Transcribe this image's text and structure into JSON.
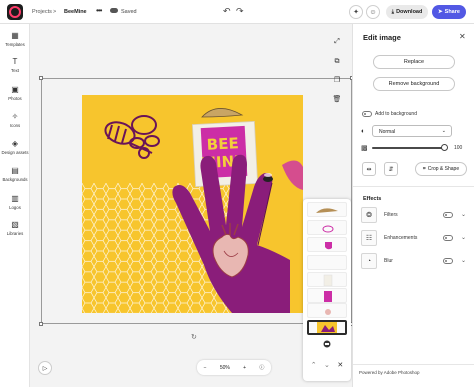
{
  "topbar": {
    "breadcrumb_projects": "Projects",
    "breadcrumb_sep": ">",
    "project_name": "BeeMine",
    "more": "•••",
    "saved_status": "Saved",
    "undo": "↶",
    "redo": "↷",
    "download_label": "Download",
    "share_label": "Share"
  },
  "sidebar": {
    "items": [
      {
        "label": "Templates",
        "icon": "▦"
      },
      {
        "label": "Text",
        "icon": "T"
      },
      {
        "label": "Photos",
        "icon": "▣"
      },
      {
        "label": "Icons",
        "icon": "✧"
      },
      {
        "label": "Design assets",
        "icon": "◈"
      },
      {
        "label": "Backgrounds",
        "icon": "▤"
      },
      {
        "label": "Logos",
        "icon": "▥"
      },
      {
        "label": "Libraries",
        "icon": "▧"
      }
    ]
  },
  "artwork": {
    "headline_line1": "BEE",
    "headline_line2": "MINE"
  },
  "zoom": {
    "minus": "−",
    "value": "50%",
    "plus": "+",
    "info": "ⓘ"
  },
  "panel": {
    "title": "Edit image",
    "close": "✕",
    "replace_label": "Replace",
    "remove_bg_label": "Remove background",
    "add_to_background_label": "Add to background",
    "blend_mode": "Normal",
    "opacity_value": "100",
    "opacity": 1.0,
    "crop_label": "Crop & Shape",
    "effects_title": "Effects",
    "effects": [
      {
        "label": "Filters",
        "icon": "❂"
      },
      {
        "label": "Enhancements",
        "icon": "☷"
      },
      {
        "label": "Blur",
        "icon": "◔"
      }
    ],
    "powered_by": "Powered by Adobe Photoshop"
  },
  "colors": {
    "accent": "#5258e4",
    "artboard_bg": "#f7c52d",
    "hand": "#8a1d7a",
    "magenta": "#cc2ea6",
    "outline": "#6a1458"
  }
}
